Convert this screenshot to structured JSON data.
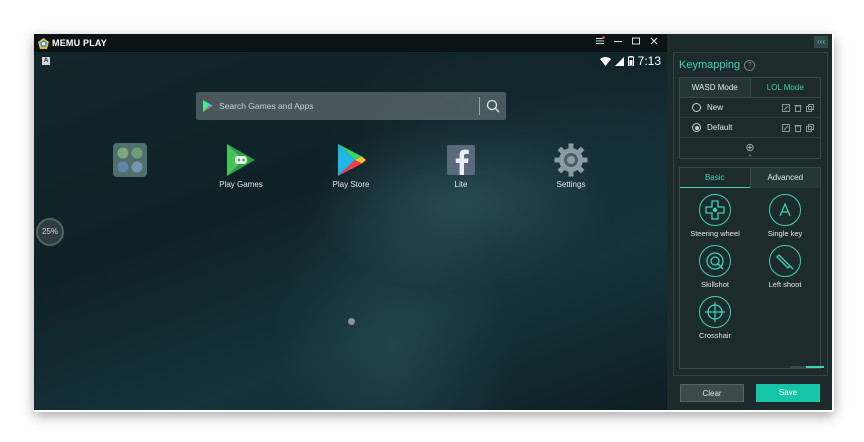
{
  "app": {
    "name": "MEMU PLAY",
    "accent_color": "#3fd0b7"
  },
  "titlebar": {
    "menu_icon": "hamburger-menu-icon",
    "minimize_icon": "minimize-icon",
    "maximize_icon": "maximize-icon",
    "close_icon": "close-icon"
  },
  "statusbar": {
    "badge": "A",
    "time": "7:13"
  },
  "search": {
    "placeholder": "Search Games and Apps"
  },
  "apps": [
    {
      "label": "",
      "icon": "app-folder-icon"
    },
    {
      "label": "Play Games",
      "icon": "play-games-icon"
    },
    {
      "label": "Play Store",
      "icon": "play-store-icon"
    },
    {
      "label": "Lite",
      "icon": "facebook-lite-icon"
    },
    {
      "label": "Settings",
      "icon": "settings-gear-icon"
    }
  ],
  "progress": {
    "text": "25%"
  },
  "panel": {
    "collapse_label": "‹‹‹",
    "title": "Keymapping",
    "mode_tabs": [
      "WASD Mode",
      "LOL Mode"
    ],
    "profiles": [
      {
        "name": "New",
        "selected": false
      },
      {
        "name": "Default",
        "selected": true
      }
    ],
    "add_label": "⊕",
    "key_tabs": [
      "Basic",
      "Advanced"
    ],
    "keys": [
      {
        "label": "Steering wheel",
        "icon": "steering-wheel-icon"
      },
      {
        "label": "Single key",
        "icon": "single-key-icon"
      },
      {
        "label": "Skillshot",
        "icon": "skillshot-icon"
      },
      {
        "label": "Left shoot",
        "icon": "left-shoot-icon"
      },
      {
        "label": "Crosshair",
        "icon": "crosshair-icon"
      }
    ],
    "clear_label": "Clear",
    "save_label": "Save"
  }
}
